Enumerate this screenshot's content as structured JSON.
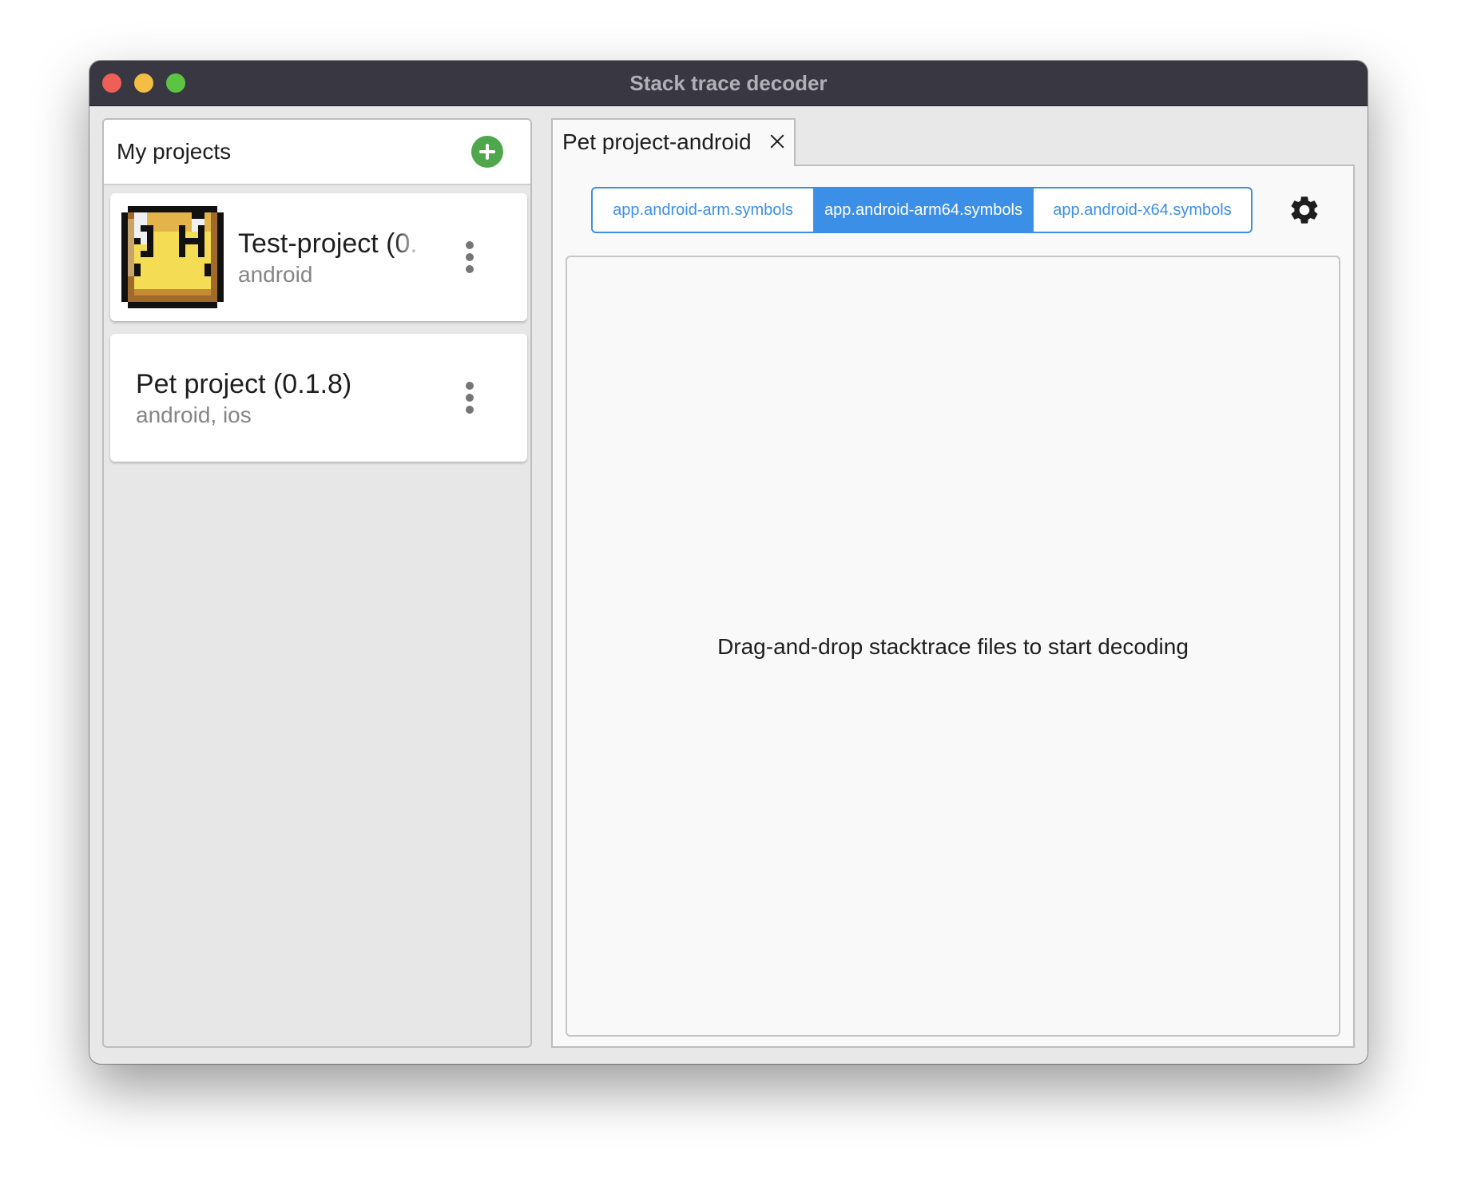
{
  "window": {
    "title": "Stack trace decoder"
  },
  "sidebar": {
    "title": "My projects",
    "add_icon": "plus-circle-icon",
    "projects": [
      {
        "name": "Test-project (0.",
        "platforms": "android",
        "has_avatar": true
      },
      {
        "name": "Pet project (0.1.8)",
        "platforms": "android, ios",
        "has_avatar": false
      }
    ]
  },
  "tabs": [
    {
      "label": "Pet project-android",
      "close_icon": "close-icon"
    }
  ],
  "symbols": {
    "options": [
      "app.android-arm.symbols",
      "app.android-arm64.symbols",
      "app.android-x64.symbols"
    ],
    "selected": "app.android-arm64.symbols"
  },
  "settings_icon": "gear-icon",
  "drop_zone": {
    "message": "Drag-and-drop stacktrace files to start decoding"
  },
  "colors": {
    "titlebar": "#393842",
    "accent": "#3c8fe6",
    "add_button": "#4ea64d",
    "traffic_close": "#ee5f57",
    "traffic_minimize": "#f4bd43",
    "traffic_maximize": "#5cc443"
  }
}
